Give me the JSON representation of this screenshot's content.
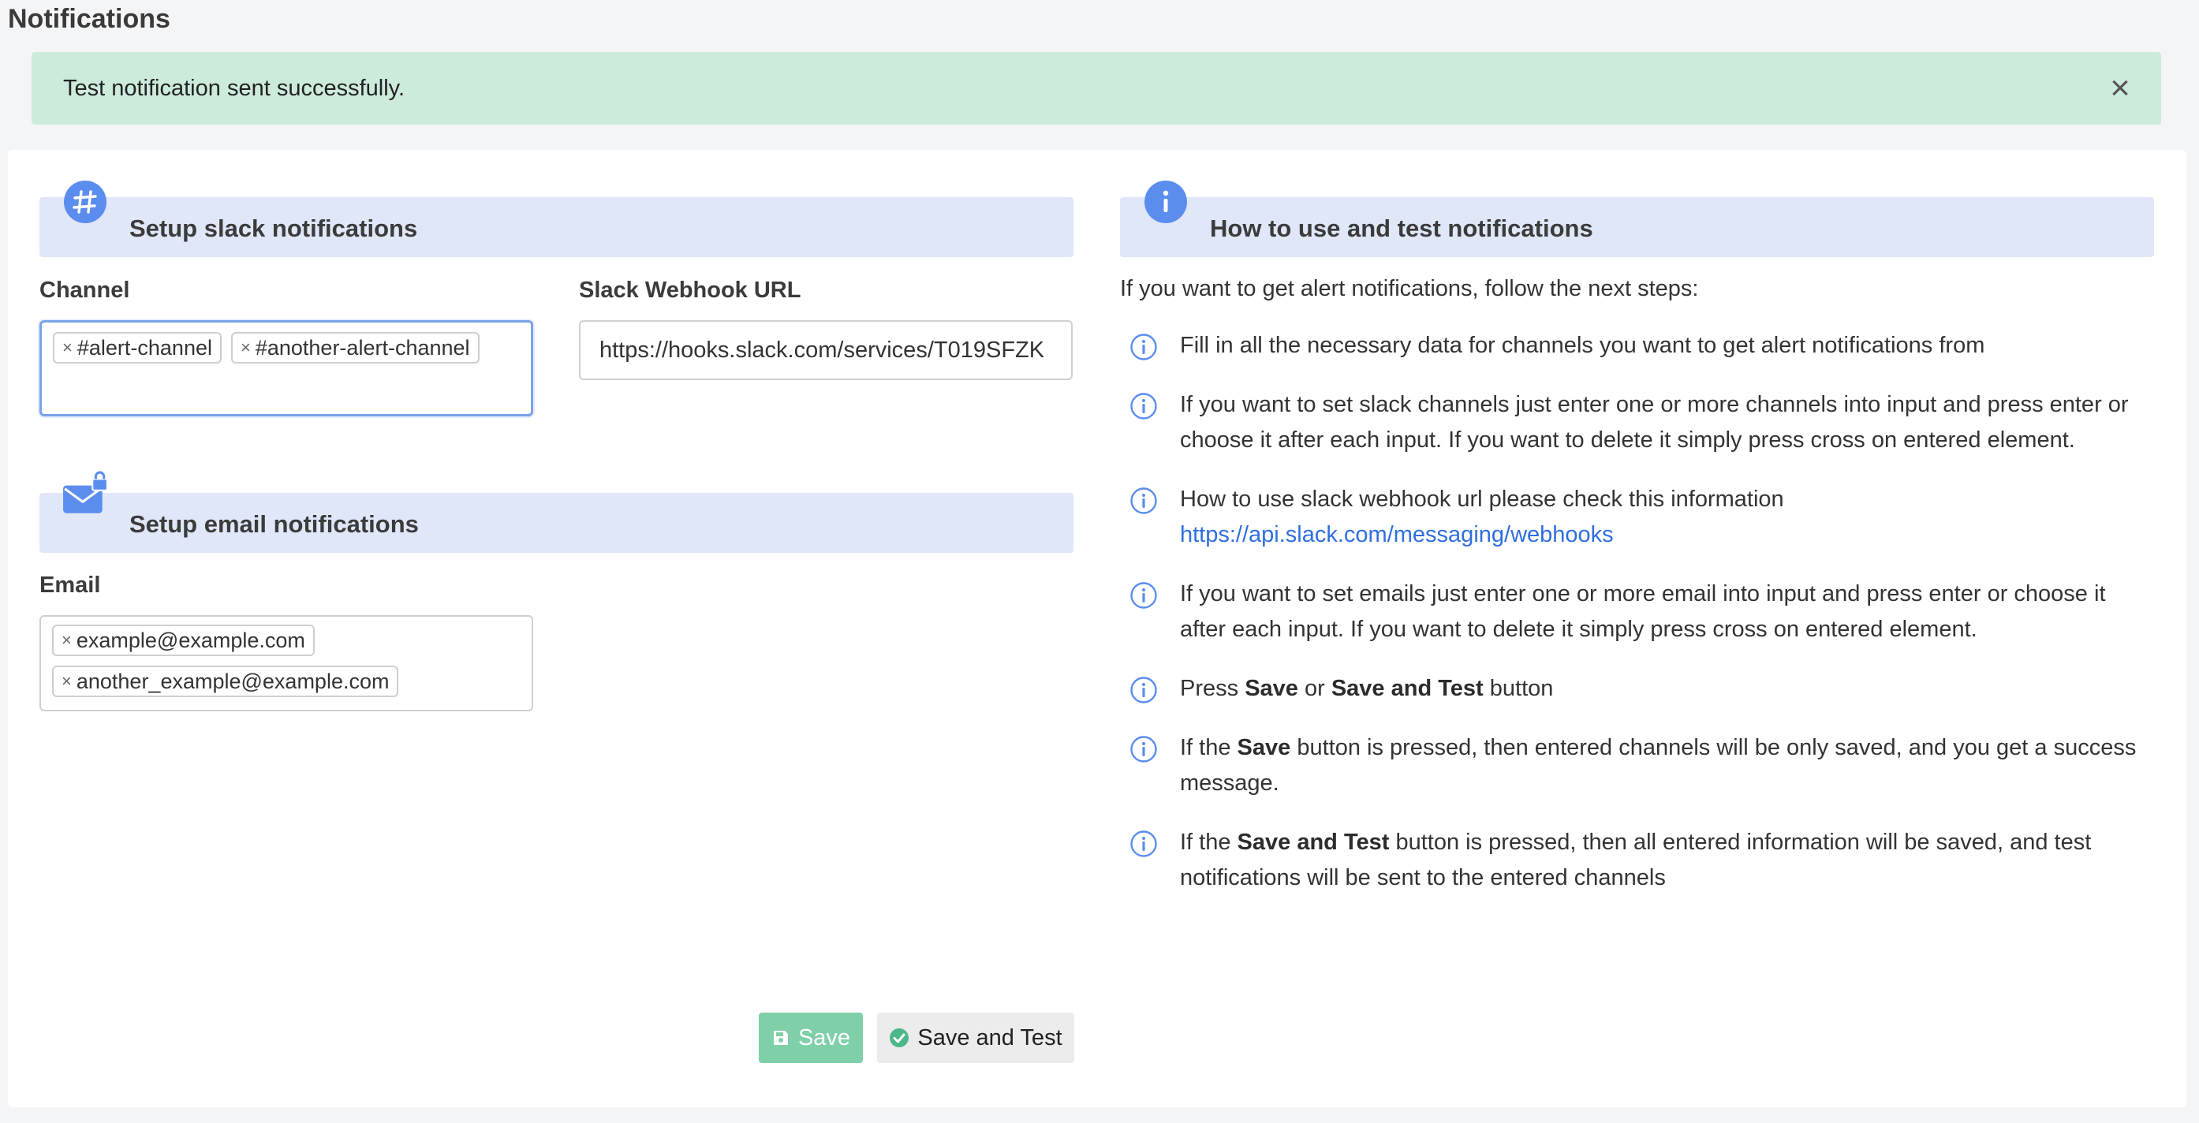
{
  "page": {
    "title": "Notifications"
  },
  "alert": {
    "message": "Test notification sent successfully.",
    "close_icon": "close-icon",
    "color": "#cdebdb"
  },
  "slack": {
    "header": "Setup slack notifications",
    "icon": "slack-icon",
    "channel_label": "Channel",
    "channels": [
      "#alert-channel",
      "#another-alert-channel"
    ],
    "webhook_label": "Slack Webhook URL",
    "webhook_value": "https://hooks.slack.com/services/T019SFZK"
  },
  "email": {
    "header": "Setup email notifications",
    "icon": "mail-lock-icon",
    "email_label": "Email",
    "emails": [
      "example@example.com",
      "another_example@example.com"
    ]
  },
  "help": {
    "header": "How to use and test notifications",
    "icon": "info-icon",
    "intro": "If you want to get alert notifications, follow the next steps:",
    "steps": [
      {
        "parts": [
          "Fill in all the necessary data for channels you want to get alert notifications from"
        ]
      },
      {
        "parts": [
          "If you want to set slack channels just enter one or more channels into input and press enter or choose it after each input. If you want to delete it simply press cross on entered element."
        ]
      },
      {
        "parts": [
          "How to use slack webhook url please check this information"
        ],
        "link": "https://api.slack.com/messaging/webhooks"
      },
      {
        "parts": [
          "If you want to set emails just enter one or more email into input and press enter or choose it after each input. If you want to delete it simply press cross on entered element."
        ]
      },
      {
        "parts": [
          "Press ",
          "Save",
          " or ",
          "Save and Test",
          " button"
        ]
      },
      {
        "parts": [
          "If the ",
          "Save",
          " button is pressed, then entered channels will be only saved, and you get a success message."
        ]
      },
      {
        "parts": [
          "If the ",
          "Save and Test",
          " button is pressed, then all entered information will be saved, and test notifications will be sent to the entered channels"
        ]
      }
    ]
  },
  "actions": {
    "save_label": "Save",
    "save_test_label": "Save and Test",
    "save_color": "#7fd0a8"
  },
  "colors": {
    "accent": "#2f6fe0",
    "header_bg": "#dfe7f8",
    "icon_blue": "#5b8def"
  }
}
